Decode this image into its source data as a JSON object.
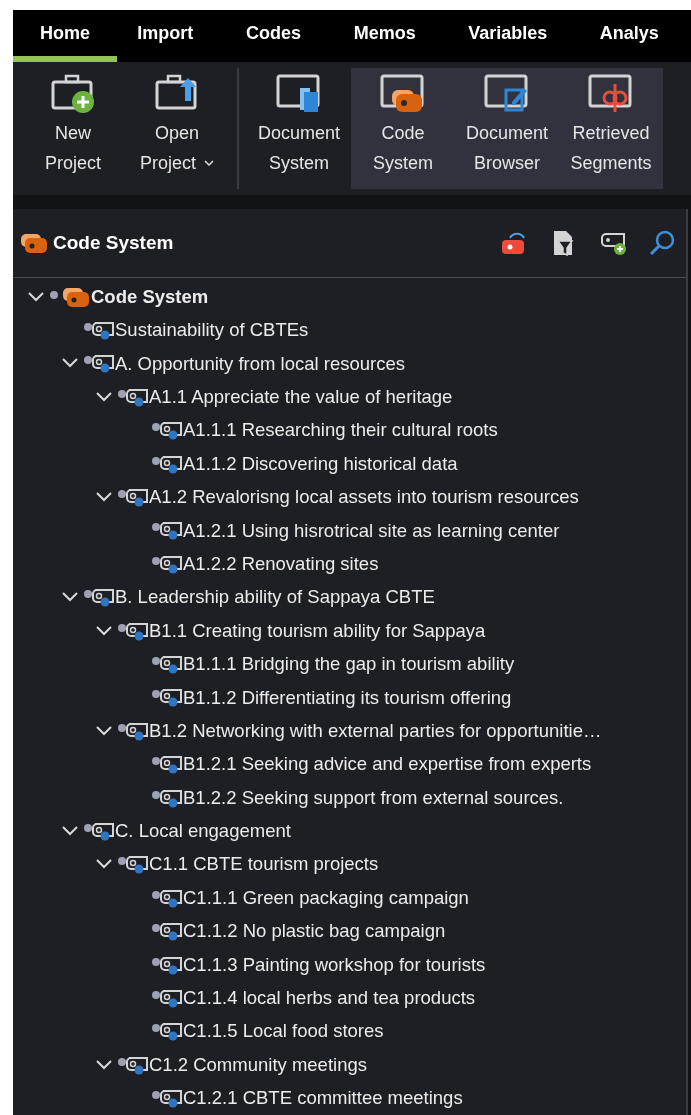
{
  "tabs": [
    {
      "label": "Home",
      "selected": true
    },
    {
      "label": "Import",
      "selected": false
    },
    {
      "label": "Codes",
      "selected": false
    },
    {
      "label": "Memos",
      "selected": false
    },
    {
      "label": "Variables",
      "selected": false
    },
    {
      "label": "Analys",
      "selected": false
    }
  ],
  "toolbar": [
    {
      "kind": "new-project",
      "label": "New Project",
      "active": false
    },
    {
      "kind": "open-project",
      "label": "Open Project",
      "active": false,
      "dropdown": true
    },
    {
      "kind": "separator"
    },
    {
      "kind": "document-system",
      "label": "Document System",
      "active": false
    },
    {
      "kind": "code-system",
      "label": "Code System",
      "active": true
    },
    {
      "kind": "document-browser",
      "label": "Document Browser",
      "active": true
    },
    {
      "kind": "retrieved-segments",
      "label": "Retrieved Segments",
      "active": true
    }
  ],
  "panel": {
    "title": "Code System"
  },
  "tree": [
    {
      "kind": "root",
      "label": "Code System",
      "expanded": true,
      "children": [
        {
          "label": "Sustainability of CBTEs"
        },
        {
          "label": "A. Opportunity from local resources",
          "expanded": true,
          "children": [
            {
              "label": "A1.1 Appreciate the value of heritage",
              "expanded": true,
              "children": [
                {
                  "label": "A1.1.1 Researching their cultural roots"
                },
                {
                  "label": "A1.1.2 Discovering historical data"
                }
              ]
            },
            {
              "label": "A1.2 Revalorisng local assets into tourism resources",
              "expanded": true,
              "children": [
                {
                  "label": "A1.2.1 Using hisrotrical site as learning center"
                },
                {
                  "label": "A1.2.2 Renovating sites"
                }
              ]
            }
          ]
        },
        {
          "label": "B. Leadership ability of Sappaya CBTE",
          "expanded": true,
          "children": [
            {
              "label": "B1.1 Creating tourism ability for Sappaya",
              "expanded": true,
              "children": [
                {
                  "label": "B1.1.1 Bridging the gap in tourism ability"
                },
                {
                  "label": "B1.1.2 Differentiating its tourism offering"
                }
              ]
            },
            {
              "label": "B1.2 Networking with external parties for opportunitie…",
              "expanded": true,
              "children": [
                {
                  "label": "B1.2.1 Seeking advice and expertise from experts"
                },
                {
                  "label": "B1.2.2 Seeking support from external sources."
                }
              ]
            }
          ]
        },
        {
          "label": "C. Local engagement",
          "expanded": true,
          "children": [
            {
              "label": "C1.1 CBTE tourism projects",
              "expanded": true,
              "children": [
                {
                  "label": "C1.1.1 Green packaging campaign"
                },
                {
                  "label": "C1.1.2 No plastic bag campaign"
                },
                {
                  "label": "C1.1.3 Painting workshop for tourists"
                },
                {
                  "label": "C1.1.4 local herbs and tea products"
                },
                {
                  "label": "C1.1.5 Local food stores"
                }
              ]
            },
            {
              "label": "C1.2 Community meetings",
              "expanded": true,
              "children": [
                {
                  "label": "C1.2.1 CBTE committee meetings"
                }
              ]
            }
          ]
        }
      ]
    }
  ]
}
